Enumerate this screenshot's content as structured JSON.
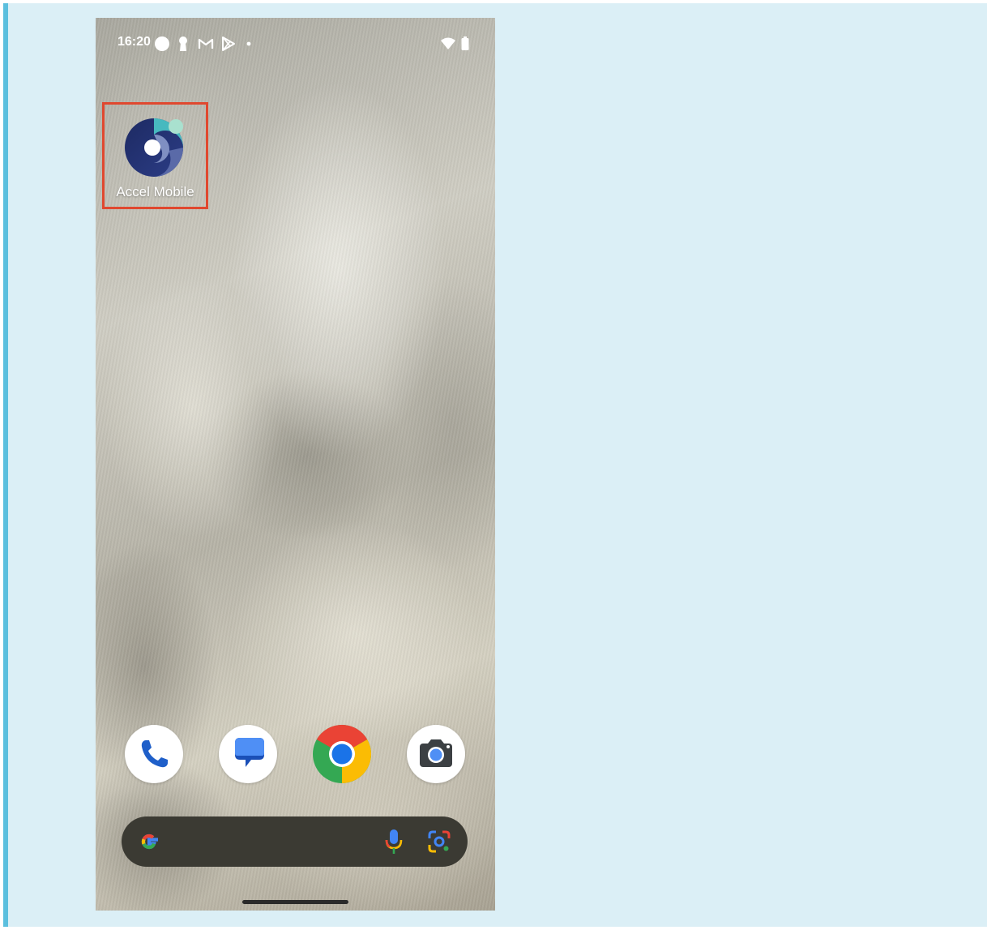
{
  "status_bar": {
    "time": "16:20",
    "left_icons": [
      "circle-icon",
      "keyhole-icon",
      "gmail-icon",
      "play-store-icon",
      "dot-icon"
    ],
    "right_icons": [
      "wifi-icon",
      "battery-icon"
    ]
  },
  "home": {
    "apps": [
      {
        "label": "Accel Mobile",
        "icon": "accel-mobile-icon",
        "highlight_color": "#e0482f"
      }
    ]
  },
  "dock": {
    "apps": [
      {
        "icon": "phone-icon"
      },
      {
        "icon": "messages-icon"
      },
      {
        "icon": "chrome-icon"
      },
      {
        "icon": "camera-icon"
      }
    ]
  },
  "search_bar": {
    "icons": [
      "google-g-icon",
      "microphone-icon",
      "google-lens-icon"
    ]
  },
  "colors": {
    "panel_background": "#dbeff6",
    "panel_border": "#5bbfde",
    "highlight": "#e0482f",
    "search_bar": "#3b3a33"
  }
}
